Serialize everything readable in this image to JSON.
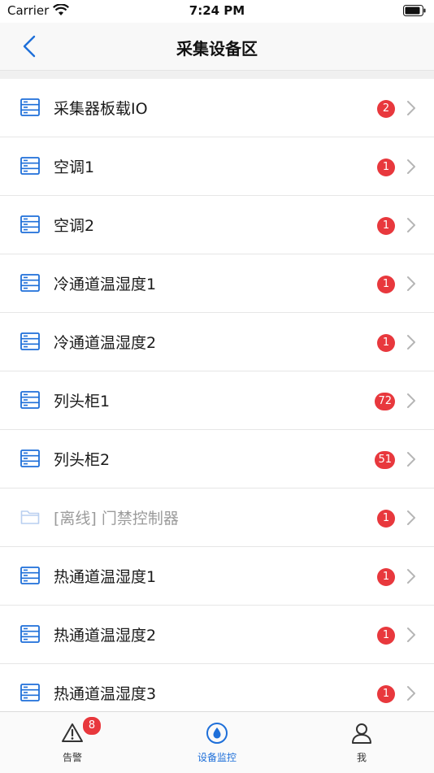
{
  "status_bar": {
    "carrier": "Carrier",
    "time": "7:24 PM"
  },
  "nav": {
    "title": "采集设备区",
    "back_icon": "chevron-left-icon"
  },
  "colors": {
    "accent": "#1e6fd9",
    "badge": "#e8383d",
    "offline_icon": "#b9cff0"
  },
  "list": {
    "items": [
      {
        "label": "采集器板载IO",
        "badge": "2",
        "icon": "server-icon"
      },
      {
        "label": "空调1",
        "badge": "1",
        "icon": "server-icon"
      },
      {
        "label": "空调2",
        "badge": "1",
        "icon": "server-icon"
      },
      {
        "label": "冷通道温湿度1",
        "badge": "1",
        "icon": "server-icon"
      },
      {
        "label": "冷通道温湿度2",
        "badge": "1",
        "icon": "server-icon"
      },
      {
        "label": "列头柜1",
        "badge": "72",
        "icon": "server-icon"
      },
      {
        "label": "列头柜2",
        "badge": "51",
        "icon": "server-icon"
      },
      {
        "label": "[离线] 门禁控制器",
        "badge": "1",
        "icon": "folder-icon",
        "offline": true
      },
      {
        "label": "热通道温湿度1",
        "badge": "1",
        "icon": "server-icon"
      },
      {
        "label": "热通道温湿度2",
        "badge": "1",
        "icon": "server-icon"
      },
      {
        "label": "热通道温湿度3",
        "badge": "1",
        "icon": "server-icon"
      }
    ]
  },
  "tab_bar": {
    "tabs": [
      {
        "label": "告警",
        "icon": "warning-icon",
        "badge": "8"
      },
      {
        "label": "设备监控",
        "icon": "monitor-drop-icon",
        "active": true
      },
      {
        "label": "我",
        "icon": "user-icon"
      }
    ]
  }
}
